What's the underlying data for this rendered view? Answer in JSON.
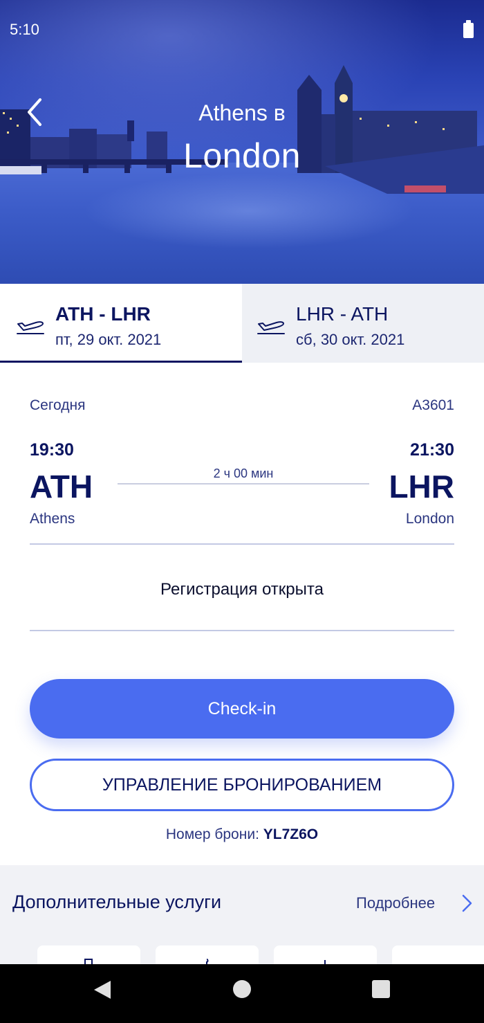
{
  "status_bar": {
    "time": "5:10"
  },
  "hero": {
    "from": "Athens в",
    "to": "London"
  },
  "tabs": [
    {
      "route": "ATH - LHR",
      "date": "пт, 29 окт. 2021",
      "active": true
    },
    {
      "route": "LHR - ATH",
      "date": "сб, 30 окт. 2021",
      "active": false
    }
  ],
  "flight": {
    "day_label": "Сегодня",
    "number": "A3601",
    "departure": {
      "time": "19:30",
      "code": "ATH",
      "city": "Athens"
    },
    "arrival": {
      "time": "21:30",
      "code": "LHR",
      "city": "London"
    },
    "duration": "2 ч 00 мин"
  },
  "checkin_status": "Регистрация открыта",
  "buttons": {
    "checkin": "Check-in",
    "manage": "УПРАВЛЕНИЕ БРОНИРОВАНИЕМ"
  },
  "booking": {
    "label": "Номер брони:",
    "code": "YL7Z6O"
  },
  "extras": {
    "title": "Дополнительные услуги",
    "more": "Подробнее"
  },
  "colors": {
    "accent": "#4a6cf0",
    "primary_text": "#0b1560",
    "tab_inactive_bg": "#eef0f5"
  }
}
